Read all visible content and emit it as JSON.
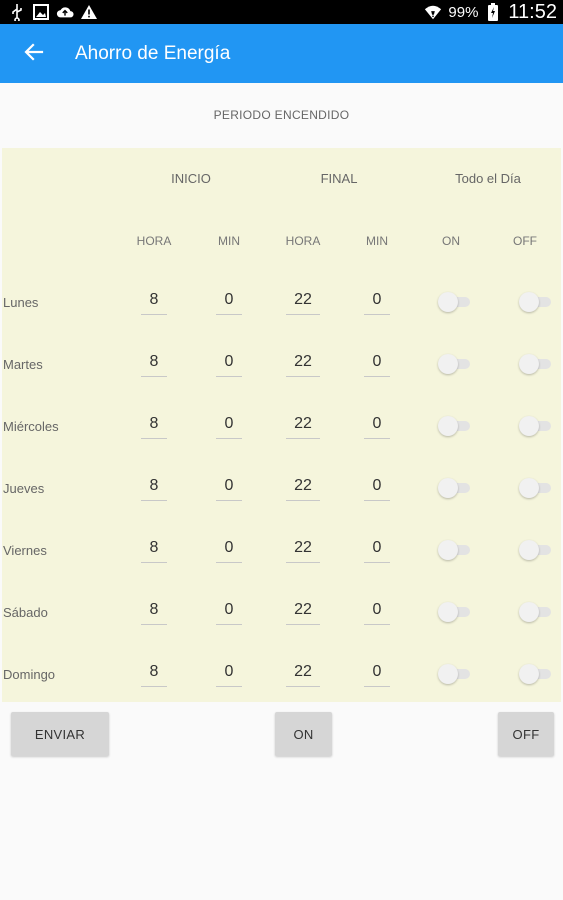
{
  "status_bar": {
    "battery": "99%",
    "time": "11:52",
    "icons": [
      "usb-icon",
      "image-icon",
      "cloud-upload-icon",
      "warning-icon",
      "wifi-icon",
      "battery-charging-icon"
    ]
  },
  "app_bar": {
    "title": "Ahorro de Energía",
    "back_icon": "arrow-back-icon",
    "color": "#2196f3"
  },
  "schedule": {
    "title": "PERIODO ENCENDIDO",
    "headers": {
      "inicio": "INICIO",
      "final": "FINAL",
      "todo_el_dia": "Todo el Día",
      "hora1": "HORA",
      "min1": "MIN",
      "hora2": "HORA",
      "min2": "MIN",
      "on": "ON",
      "off": "OFF"
    },
    "days": [
      {
        "name": "Lunes",
        "start_hour": "8",
        "start_min": "0",
        "end_hour": "22",
        "end_min": "0",
        "all_day_on": false,
        "all_day_off": false
      },
      {
        "name": "Martes",
        "start_hour": "8",
        "start_min": "0",
        "end_hour": "22",
        "end_min": "0",
        "all_day_on": false,
        "all_day_off": false
      },
      {
        "name": "Miércoles",
        "start_hour": "8",
        "start_min": "0",
        "end_hour": "22",
        "end_min": "0",
        "all_day_on": false,
        "all_day_off": false
      },
      {
        "name": "Jueves",
        "start_hour": "8",
        "start_min": "0",
        "end_hour": "22",
        "end_min": "0",
        "all_day_on": false,
        "all_day_off": false
      },
      {
        "name": "Viernes",
        "start_hour": "8",
        "start_min": "0",
        "end_hour": "22",
        "end_min": "0",
        "all_day_on": false,
        "all_day_off": false
      },
      {
        "name": "Sábado",
        "start_hour": "8",
        "start_min": "0",
        "end_hour": "22",
        "end_min": "0",
        "all_day_on": false,
        "all_day_off": false
      },
      {
        "name": "Domingo",
        "start_hour": "8",
        "start_min": "0",
        "end_hour": "22",
        "end_min": "0",
        "all_day_on": false,
        "all_day_off": false
      }
    ],
    "panel_color": "#f5f5dc"
  },
  "actions": {
    "enviar": "ENVIAR",
    "on": "ON",
    "off": "OFF"
  }
}
